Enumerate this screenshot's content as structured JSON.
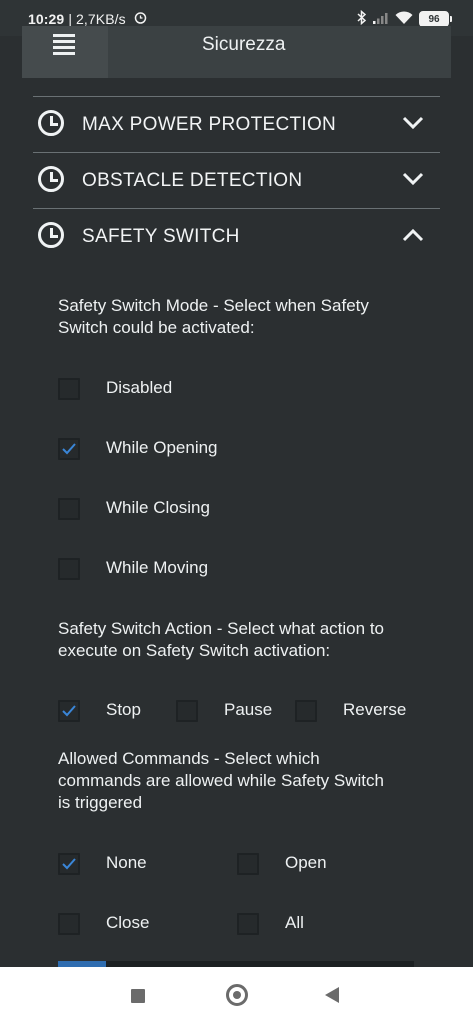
{
  "status_bar": {
    "time": "10:29",
    "network_speed": "| 2,7KB/s",
    "battery": "96"
  },
  "header": {
    "title": "Sicurezza"
  },
  "sections": [
    {
      "label": "MAX POWER PROTECTION",
      "expanded": false
    },
    {
      "label": "OBSTACLE DETECTION",
      "expanded": false
    },
    {
      "label": "SAFETY SWITCH",
      "expanded": true
    }
  ],
  "safety_switch": {
    "mode_title_line1": "Safety Switch Mode - Select when Safety",
    "mode_title_line2": "Switch could be activated:",
    "mode_options": [
      {
        "label": "Disabled",
        "checked": false
      },
      {
        "label": "While Opening",
        "checked": true
      },
      {
        "label": "While Closing",
        "checked": false
      },
      {
        "label": "While Moving",
        "checked": false
      }
    ],
    "action_title_line1": "Safety Switch Action - Select what action to",
    "action_title_line2": "execute on Safety Switch activation:",
    "action_options": [
      {
        "label": "Stop",
        "checked": true
      },
      {
        "label": "Pause",
        "checked": false
      },
      {
        "label": "Reverse",
        "checked": false
      }
    ],
    "commands_title_line1": "Allowed Commands - Select which",
    "commands_title_line2": "commands are allowed while Safety Switch",
    "commands_title_line3": "is triggered",
    "command_options": [
      {
        "label": "None",
        "checked": true
      },
      {
        "label": "Open",
        "checked": false
      },
      {
        "label": "Close",
        "checked": false
      },
      {
        "label": "All",
        "checked": false
      }
    ]
  },
  "colors": {
    "background": "#2b2f31",
    "accent": "#2f6db0",
    "check": "#3a86d8"
  }
}
